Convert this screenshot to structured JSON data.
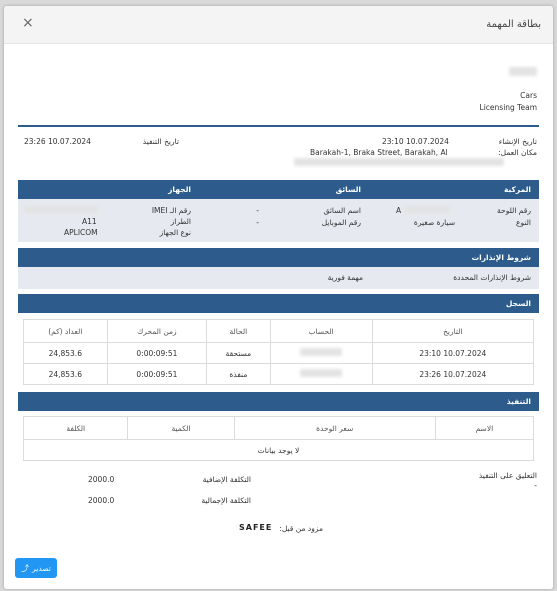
{
  "modal": {
    "title": "بطاقة المهمة",
    "close": "×"
  },
  "company": {
    "line2": "Cars",
    "line3": "Licensing Team"
  },
  "task_info": {
    "created_label": "تاريخ الإنشاء",
    "created_value": "23:10 10.07.2024",
    "workplace_label": "مكان العمل:",
    "workplace_value": "Barakah-1, Braka Street, Barakah, Al",
    "executed_label": "تاريخ التنفيذ",
    "executed_value": "23:26 10.07.2024"
  },
  "vehicle_section": {
    "col_vehicle": "المركبة",
    "col_driver": "السائق",
    "col_device": "الجهاز",
    "plate_label": "رقم اللوحة",
    "plate_value": "A",
    "type_label": "النوع",
    "type_value": "سيارة صغيرة",
    "driver_name_label": "اسم السائق",
    "driver_name_value": "-",
    "mobile_label": "رقم الموبايل",
    "mobile_value": "-",
    "imei_label": "رقم الـ IMEI",
    "model_label": "الطراز",
    "model_value": "A11",
    "device_type_label": "نوع الجهاز",
    "device_type_value": "APLICOM"
  },
  "warnings": {
    "title": "شروط الإنذارات",
    "label": "شروط الإنذارات المحددة",
    "value": "مهمة فورية"
  },
  "log": {
    "title": "السجل",
    "headers": [
      "التاريخ",
      "الحساب",
      "الحالة",
      "زمن المحرك",
      "العداد (كم)"
    ],
    "rows": [
      {
        "date": "23:10 10.07.2024",
        "status": "مستحقة",
        "engine": "0:00:09:51",
        "odometer": "24,853.6"
      },
      {
        "date": "23:26 10.07.2024",
        "status": "منفذة",
        "engine": "0:00:09:51",
        "odometer": "24,853.6"
      }
    ]
  },
  "execution": {
    "title": "التنفيذ",
    "headers": [
      "الاسم",
      "سعر الوحدة",
      "الكمية",
      "الكلفة"
    ],
    "empty": "لا يوجد بيانات"
  },
  "footer": {
    "comment_label": "التعليق على التنفيذ",
    "comment_value": "-",
    "extra_cost_label": "التكلفة الإضافية",
    "extra_cost_value": "2000.0",
    "total_cost_label": "التكلفة الإجمالية",
    "total_cost_value": "2000.0",
    "provided_by": "مزود من قبل:",
    "logo_text": "SAFEE"
  },
  "export_button": "تصدير",
  "colors": {
    "primary": "#2c5b8c",
    "button": "#2196f3",
    "panel": "#e6e9ef"
  }
}
